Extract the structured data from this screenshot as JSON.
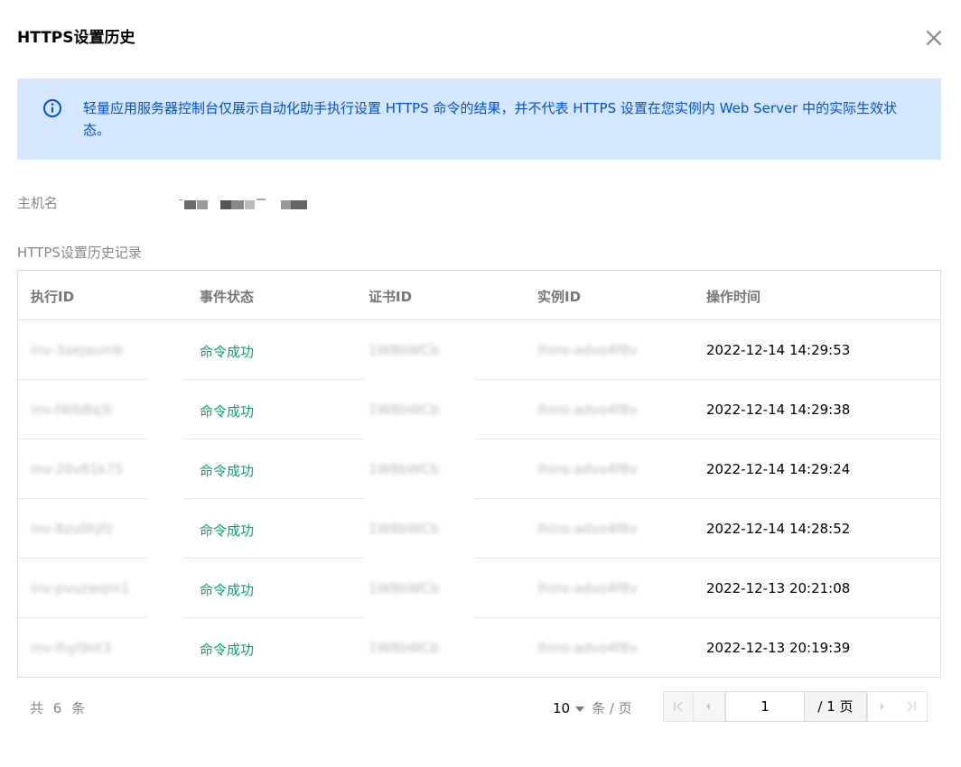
{
  "dialog": {
    "title": "HTTPS设置历史",
    "close_icon": "close-icon"
  },
  "notice": {
    "icon": "info-icon",
    "text": "轻量应用服务器控制台仅展示自动化助手执行设置 HTTPS 命令的结果，并不代表 HTTPS 设置在您实例内 Web Server 中的实际生效状态。"
  },
  "host": {
    "label": "主机名"
  },
  "history": {
    "label": "HTTPS设置历史记录",
    "columns": [
      "执行ID",
      "事件状态",
      "证书ID",
      "实例ID",
      "操作时间"
    ],
    "rows": [
      {
        "exec_id": "inv-3aejaumb",
        "status": "命令成功",
        "cert_id": "1W8bWCb",
        "instance_id": "lhins-advo4f8v",
        "time": "2022-12-14 14:29:53"
      },
      {
        "exec_id": "inv-f4tb8q3l",
        "status": "命令成功",
        "cert_id": "1W8bWCb",
        "instance_id": "lhins-advo4f8v",
        "time": "2022-12-14 14:29:38"
      },
      {
        "exec_id": "inv-20v81k75",
        "status": "命令成功",
        "cert_id": "1W8bWCb",
        "instance_id": "lhins-advo4f8v",
        "time": "2022-12-14 14:29:24"
      },
      {
        "exec_id": "inv-8zu0hjfz",
        "status": "命令成功",
        "cert_id": "1W8bWCb",
        "instance_id": "lhins-advo4f8v",
        "time": "2022-12-14 14:28:52"
      },
      {
        "exec_id": "inv-pvuzwqm1",
        "status": "命令成功",
        "cert_id": "1W8bWCb",
        "instance_id": "lhins-advo4f8v",
        "time": "2022-12-13 20:21:08"
      },
      {
        "exec_id": "inv-lhyl9nt3",
        "status": "命令成功",
        "cert_id": "1W8bWCb",
        "instance_id": "lhins-advo4f8v",
        "time": "2022-12-13 20:19:39"
      }
    ]
  },
  "pagination": {
    "total": "共 6 条",
    "page_size": "10",
    "page_size_unit": "条 / 页",
    "current_page": "1",
    "total_pages": "/ 1 页"
  },
  "colors": {
    "notice_bg": "#d5e7ff",
    "brand_blue": "#0052d9",
    "success_green": "#00a870"
  }
}
